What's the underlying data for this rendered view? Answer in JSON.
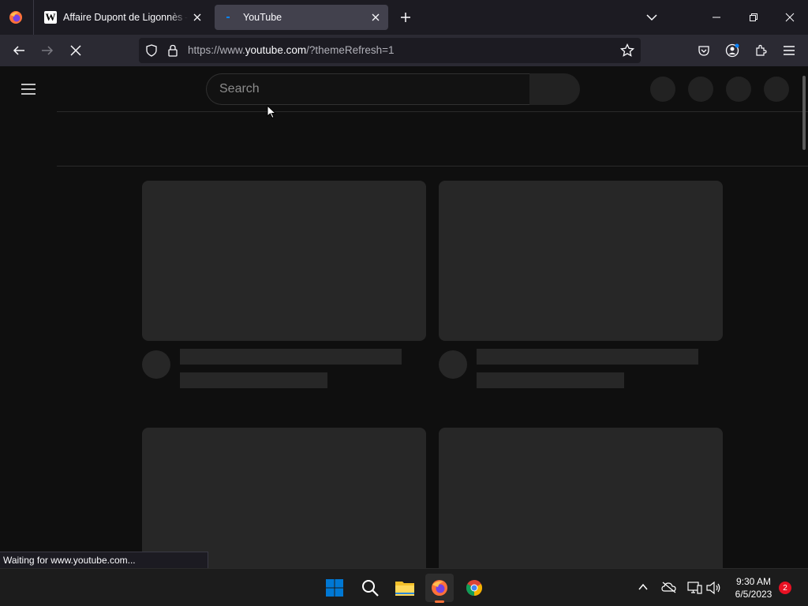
{
  "browser": {
    "tabs": [
      {
        "title": "Affaire Dupont de Ligonnès — W",
        "favicon": "W",
        "active": false
      },
      {
        "title": "YouTube",
        "active": true
      }
    ],
    "url": {
      "prefix": "https://www.",
      "host": "youtube.com",
      "path": "/?themeRefresh=1"
    },
    "status_text": "Waiting for www.youtube.com..."
  },
  "page": {
    "search_placeholder": "Search"
  },
  "taskbar": {
    "time": "9:30 AM",
    "date": "6/5/2023",
    "notification_count": "2"
  },
  "colors": {
    "firefox_orange": "#ff7139",
    "windows_blue": "#0078d4",
    "folder_yellow": "#f4c02a",
    "chrome_red": "#db4437",
    "chrome_yellow": "#f4b400",
    "chrome_green": "#0f9d58",
    "chrome_blue": "#4285f4"
  }
}
